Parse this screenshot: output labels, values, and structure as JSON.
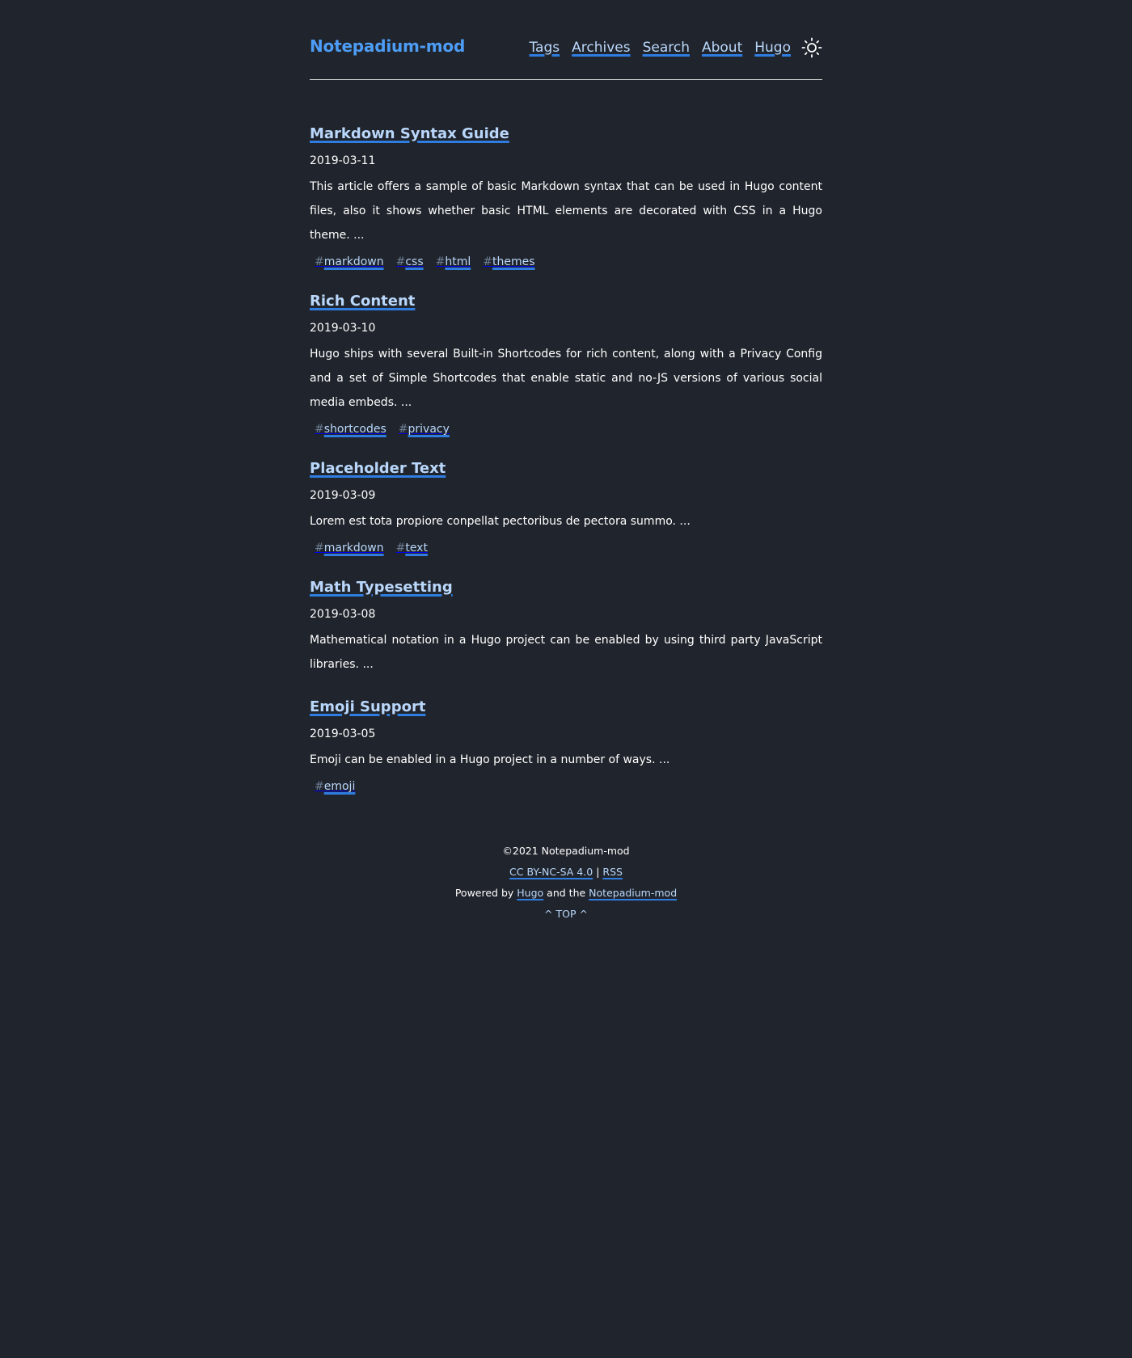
{
  "header": {
    "brand": "Notepadium-mod",
    "nav": [
      "Tags",
      "Archives",
      "Search",
      "About",
      "Hugo"
    ],
    "theme_toggle_icon": "sun-icon"
  },
  "posts": [
    {
      "title": "Markdown Syntax Guide",
      "date": "2019-03-11",
      "summary": "This article offers a sample of basic Markdown syntax that can be used in Hugo content files, also it shows whether basic HTML elements are decorated with CSS in a Hugo theme. ...",
      "tags": [
        "markdown",
        "css",
        "html",
        "themes"
      ]
    },
    {
      "title": "Rich Content",
      "date": "2019-03-10",
      "summary": "Hugo ships with several Built-in Shortcodes for rich content, along with a Privacy Config and a set of Simple Shortcodes that enable static and no-JS versions of various social media embeds. ...",
      "tags": [
        "shortcodes",
        "privacy"
      ]
    },
    {
      "title": "Placeholder Text",
      "date": "2019-03-09",
      "summary": "Lorem est tota propiore conpellat pectoribus de pectora summo. ...",
      "tags": [
        "markdown",
        "text"
      ]
    },
    {
      "title": "Math Typesetting",
      "date": "2019-03-08",
      "summary": "Mathematical notation in a Hugo project can be enabled by using third party JavaScript libraries. ...",
      "tags": []
    },
    {
      "title": "Emoji Support",
      "date": "2019-03-05",
      "summary": "Emoji can be enabled in a Hugo project in a number of ways. ...",
      "tags": [
        "emoji"
      ]
    }
  ],
  "footer": {
    "copyright": "©2021 Notepadium-mod",
    "license": "CC BY-NC-SA 4.0",
    "separator": "|",
    "rss": "RSS",
    "powered_by": "Powered by",
    "hugo": "Hugo",
    "and_the": "and the",
    "theme": "Notepadium-mod",
    "top": "^ TOP ^"
  },
  "colors": {
    "background": "#20242c",
    "brand": "#4d9df6",
    "link": "#b9d7fb",
    "underline": "#2f7de0"
  }
}
